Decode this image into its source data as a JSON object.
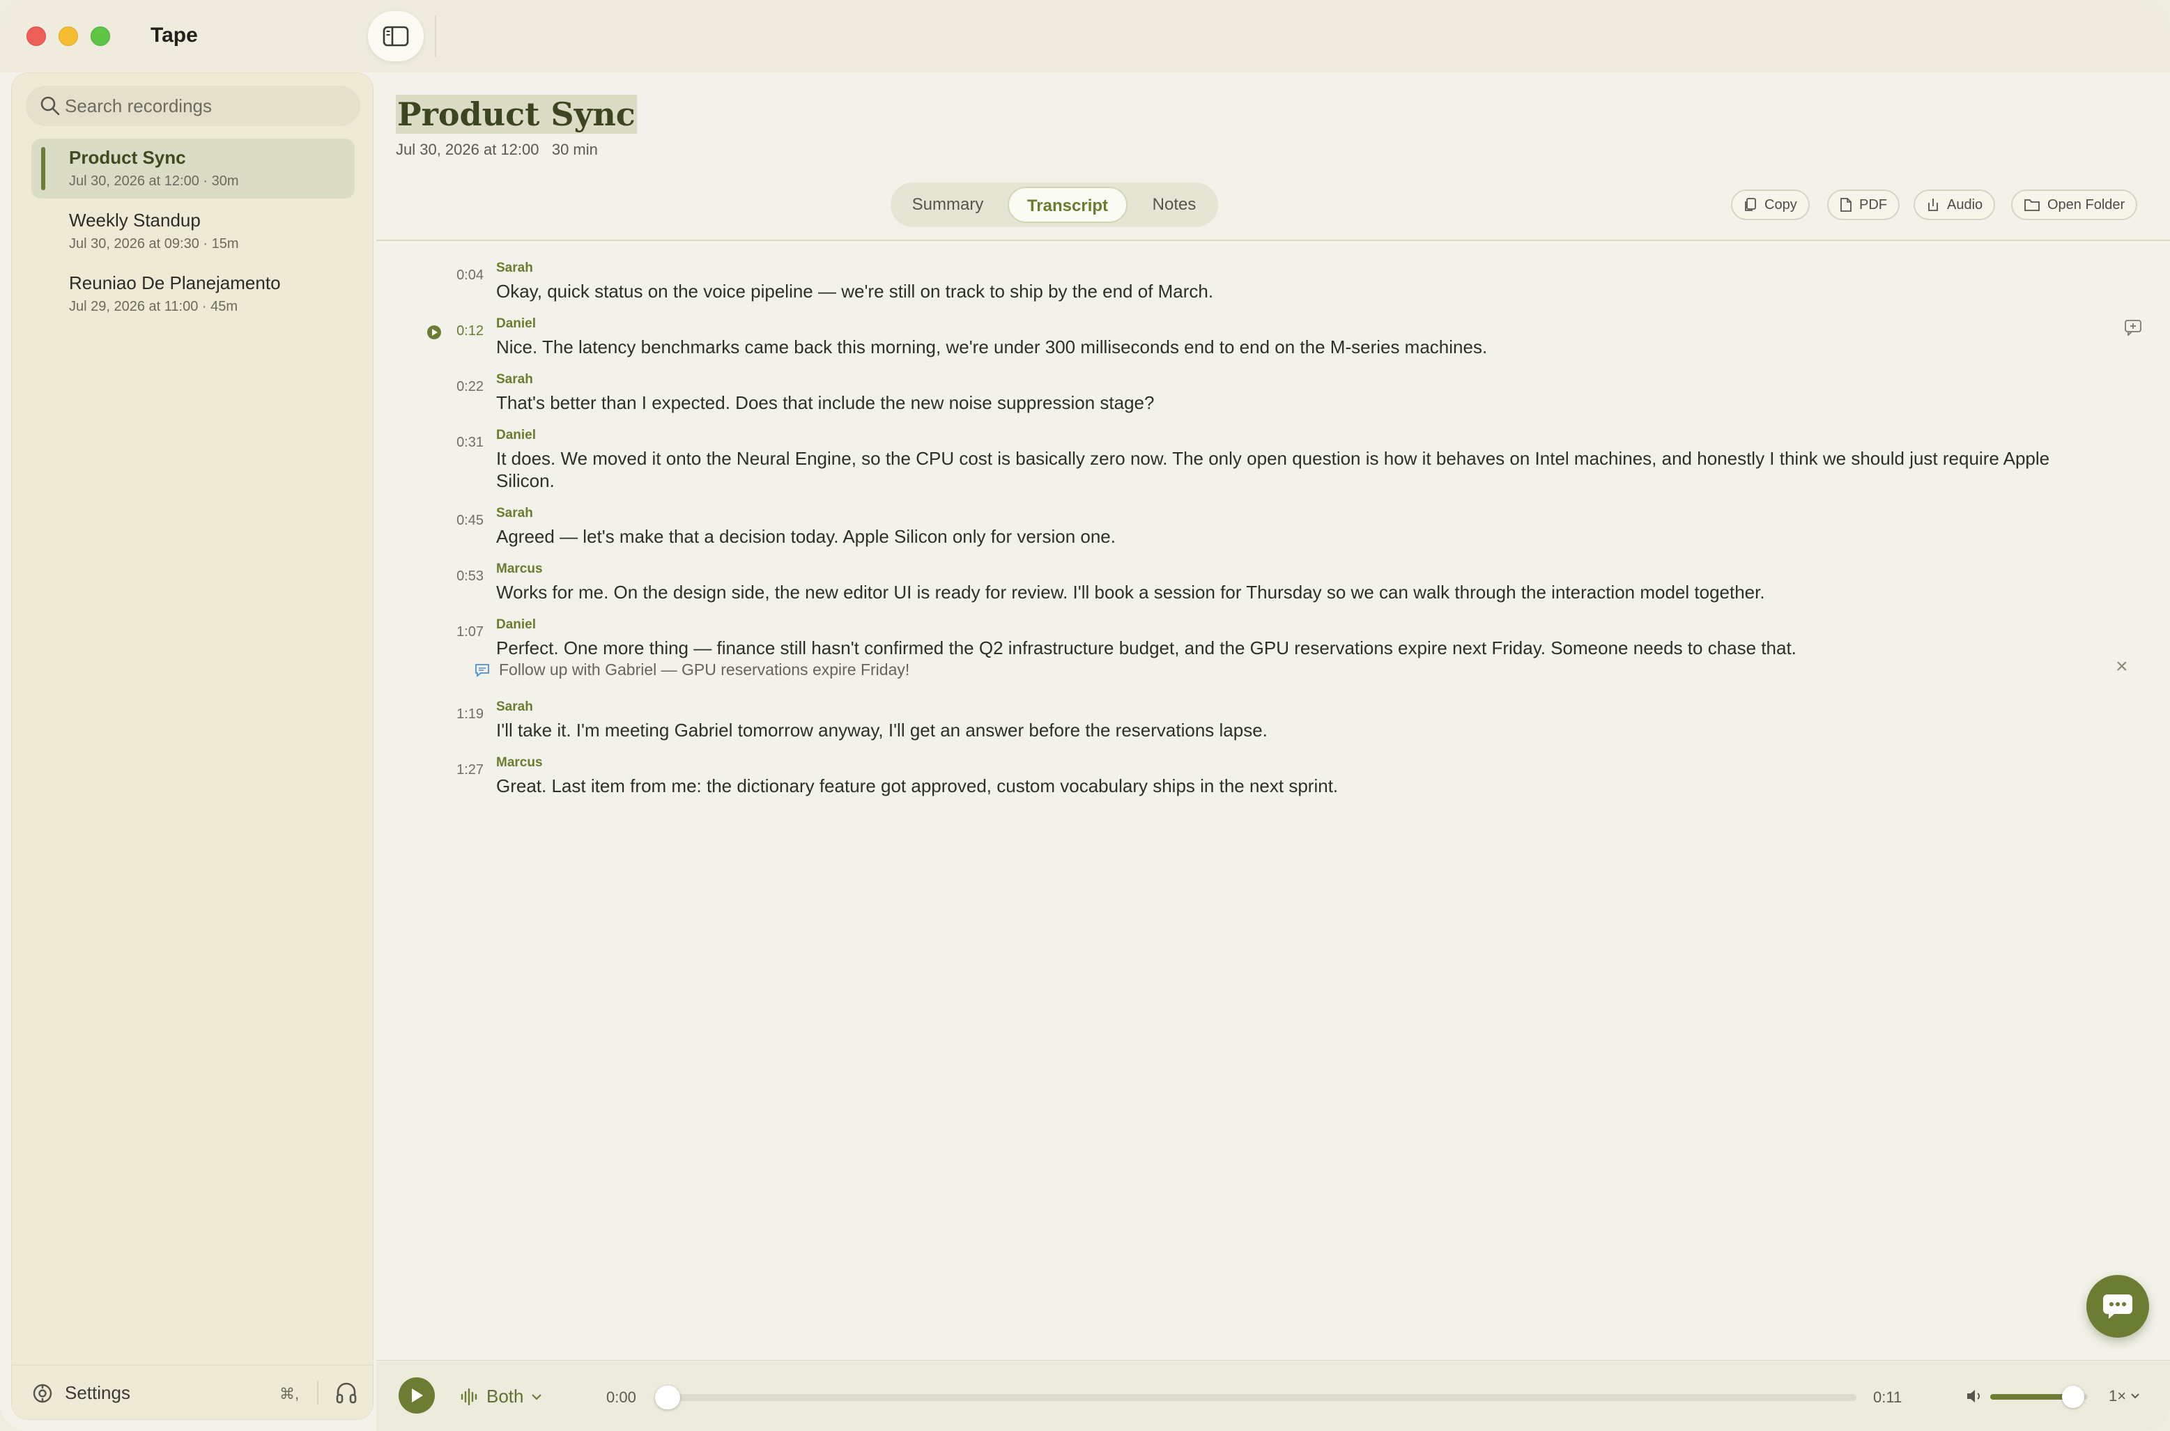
{
  "app": {
    "title": "Tape"
  },
  "sidebar": {
    "search_placeholder": "Search recordings",
    "recordings": [
      {
        "name": "Product Sync",
        "meta": "Jul 30, 2026 at 12:00  · 30m",
        "active": true
      },
      {
        "name": "Weekly Standup",
        "meta": "Jul 30, 2026 at 09:30  · 15m",
        "active": false
      },
      {
        "name": "Reuniao De Planejamento",
        "meta": "Jul 29, 2026 at 11:00  · 45m",
        "active": false
      }
    ],
    "settings_label": "Settings",
    "settings_shortcut": "⌘,"
  },
  "recording": {
    "title": "Product Sync",
    "meta": "Jul 30, 2026 at 12:00   30 min"
  },
  "tabs": [
    {
      "label": "Summary",
      "active": false
    },
    {
      "label": "Transcript",
      "active": true
    },
    {
      "label": "Notes",
      "active": false
    }
  ],
  "actions": {
    "copy": "Copy",
    "pdf": "PDF",
    "audio": "Audio",
    "open_folder": "Open Folder"
  },
  "transcript": [
    {
      "time": "0:04",
      "speaker": "Sarah",
      "text": "Okay, quick status on the voice pipeline — we're still on track to ship by the end of March."
    },
    {
      "time": "0:12",
      "speaker": "Daniel",
      "text": "Nice. The latency benchmarks came back this morning, we're under 300 milliseconds end to end on the M-series machines.",
      "playing": true
    },
    {
      "time": "0:22",
      "speaker": "Sarah",
      "text": "That's better than I expected. Does that include the new noise suppression stage?"
    },
    {
      "time": "0:31",
      "speaker": "Daniel",
      "text": "It does. We moved it onto the Neural Engine, so the CPU cost is basically zero now. The only open question is how it behaves on Intel machines, and honestly I think we should just require Apple Silicon."
    },
    {
      "time": "0:45",
      "speaker": "Sarah",
      "text": "Agreed — let's make that a decision today. Apple Silicon only for version one."
    },
    {
      "time": "0:53",
      "speaker": "Marcus",
      "text": "Works for me. On the design side, the new editor UI is ready for review. I'll book a session for Thursday so we can walk through the interaction model together."
    },
    {
      "time": "1:07",
      "speaker": "Daniel",
      "text": "Perfect. One more thing — finance still hasn't confirmed the Q2 infrastructure budget, and the GPU reservations expire next Friday. Someone needs to chase that.",
      "note": "Follow up with Gabriel — GPU reservations expire Friday!"
    },
    {
      "time": "1:19",
      "speaker": "Sarah",
      "text": "I'll take it. I'm meeting Gabriel tomorrow anyway, I'll get an answer before the reservations lapse."
    },
    {
      "time": "1:27",
      "speaker": "Marcus",
      "text": "Great. Last item from me: the dictionary feature got approved, custom vocabulary ships in the next sprint."
    }
  ],
  "player": {
    "channel": "Both",
    "time_start": "0:00",
    "time_end": "0:11",
    "progress": 0,
    "volume": 0.85,
    "speed": "1×"
  },
  "colors": {
    "accent": "#6b7d33",
    "sidebar_bg": "#efead6",
    "main_bg": "#f3f2ea"
  }
}
